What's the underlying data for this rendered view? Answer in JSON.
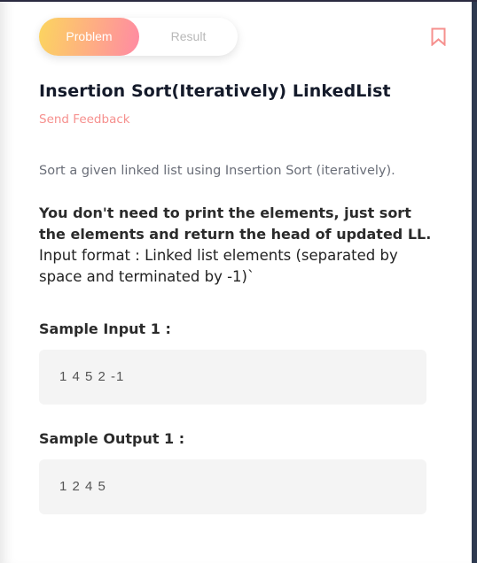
{
  "tabs": {
    "problem": "Problem",
    "result": "Result"
  },
  "title": "Insertion Sort(Iteratively) LinkedList",
  "send_feedback": "Send Feedback",
  "description": "Sort a given linked list using Insertion Sort (iteratively).",
  "note_bold": "You don't need to print the elements, just sort the elements and return the head of updated LL.",
  "input_format": "Input format : Linked list elements (separated by space and terminated by -1)`",
  "sample_input_label": "Sample Input 1 :",
  "sample_input": "1 4 5 2 -1",
  "sample_output_label": "Sample Output 1 :",
  "sample_output": "1 2 4 5",
  "colors": {
    "accent": "#f6908e",
    "gradient_start": "#fcd55f",
    "gradient_end": "#ff8aa3"
  }
}
